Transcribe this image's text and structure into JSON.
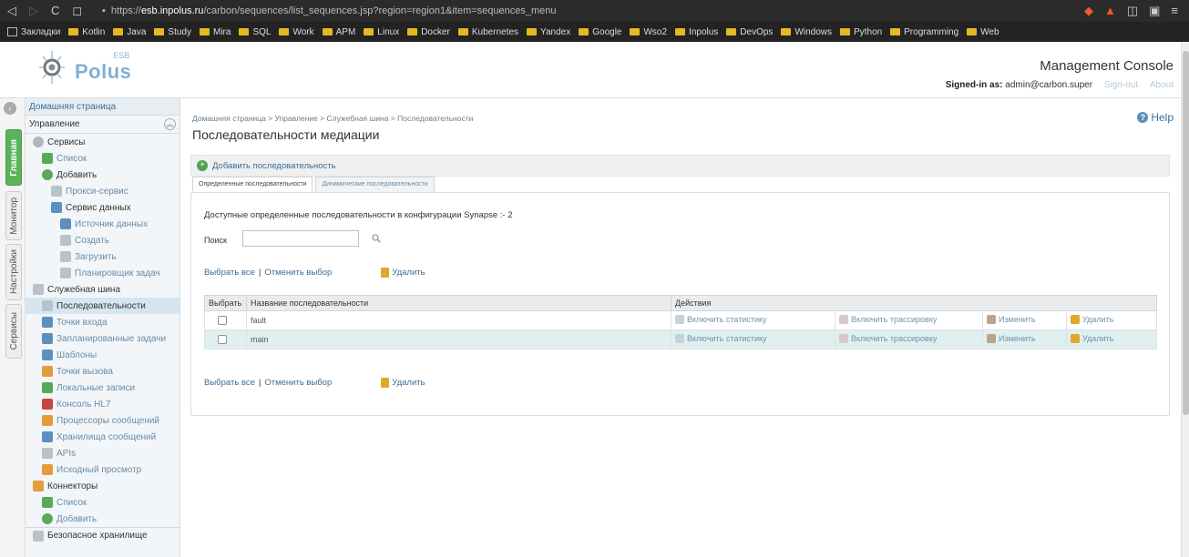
{
  "browser": {
    "url_prefix": "https://",
    "url_host": "esb.inpolus.ru",
    "url_path": "/carbon/sequences/list_sequences.jsp?region=region1&item=sequences_menu"
  },
  "bookmarks": {
    "first": "Закладки",
    "folders": [
      "Kotlin",
      "Java",
      "Study",
      "Mira",
      "SQL",
      "Work",
      "APM",
      "Linux",
      "Docker",
      "Kubernetes",
      "Yandex",
      "Google",
      "Wso2",
      "Inpolus",
      "DevOps",
      "Windows",
      "Python",
      "Programming",
      "Web"
    ]
  },
  "header": {
    "logo_small": "ESB",
    "logo_name": "Polus",
    "console_title": "Management Console",
    "signed_label": "Signed-in as:",
    "signed_user": "admin@carbon.super",
    "sign_out": "Sign-out",
    "about": "About"
  },
  "vtabs": [
    "Главная",
    "Монитор",
    "Настройки",
    "Сервисы"
  ],
  "nav": {
    "home": "Домашняя страница",
    "section": "Управление",
    "services": "Сервисы",
    "list": "Список",
    "add": "Добавить",
    "proxy": "Прокси-сервис",
    "data_service": "Сервис данных",
    "data_source": "Источник данных",
    "create": "Создать",
    "upload": "Загрузить",
    "task_scheduler": "Планировщик задач",
    "service_bus": "Служебная шина",
    "sequences": "Последовательности",
    "endpoints_in": "Точки входа",
    "scheduled_tasks": "Запланированные задачи",
    "templates": "Шаблоны",
    "endpoints_out": "Точки вызова",
    "local_entries": "Локальные записи",
    "hl7_console": "Консоль HL7",
    "message_processors": "Процессоры сообщений",
    "message_stores": "Хранилища сообщений",
    "apis": "APIs",
    "source_view": "Исходный просмотр",
    "connectors": "Коннекторы",
    "conn_list": "Список",
    "conn_add": "Добавить",
    "secure_vault": "Безопасное хранилище"
  },
  "main": {
    "breadcrumb": "Домашняя страница > Управление > Служебная шина > Последовательности",
    "help": "Help",
    "title": "Последовательности медиации",
    "add_sequence": "Добавить последовательность",
    "tab_defined": "Определенные последовательности",
    "tab_dynamic": "Динамические последовательности",
    "available": "Доступные определенные последовательности в конфигурации Synapse :- 2",
    "search_label": "Поиск",
    "search_value": "",
    "select_all": "Выбрать все",
    "deselect": "Отменить выбор",
    "delete": "Удалить"
  },
  "table": {
    "col_select": "Выбрать",
    "col_name": "Название последовательности",
    "col_actions": "Действия",
    "rows": [
      {
        "name": "fault",
        "stat": "Включить статистику",
        "trace": "Включить трассировку",
        "edit": "Изменить",
        "delete": "Удалить"
      },
      {
        "name": "main",
        "stat": "Включить статистику",
        "trace": "Включить трассировку",
        "edit": "Изменить",
        "delete": "Удалить"
      }
    ]
  }
}
